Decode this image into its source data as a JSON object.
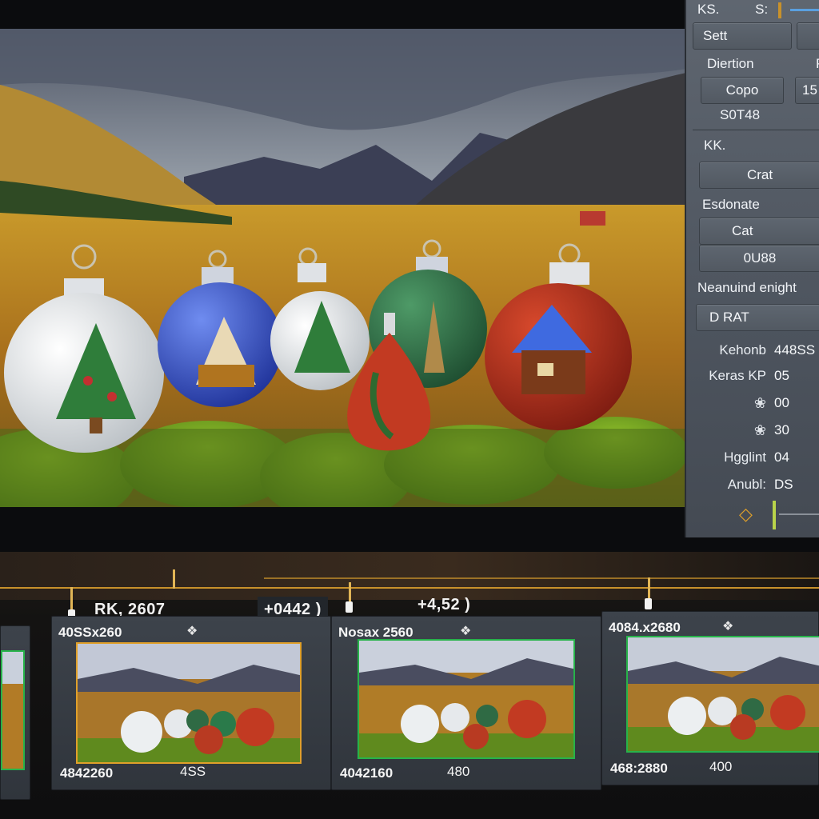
{
  "inspector": {
    "top_left": "KS.",
    "top_mid": "S:",
    "set_label": "Sett",
    "direction_label": "Diertion",
    "direction_right": "P",
    "copo_button": "Copo",
    "copo_value": "15",
    "code": "S0T48",
    "kk_label": "KK.",
    "crat_button": "Crat",
    "estimate_label": "Esdonate",
    "cat_label": "Cat",
    "value_field": "0U88",
    "height_label": "Neanuind enight",
    "drat_button": "D RAT",
    "kv": [
      {
        "key": "Kehonb",
        "value": "448SS"
      },
      {
        "key": "Keras KP",
        "value": "05"
      },
      {
        "key": "❀",
        "value": "00"
      },
      {
        "key": "❀",
        "value": "30"
      },
      {
        "key": "Hgglint",
        "value": "04"
      },
      {
        "key": "Anubl:",
        "value": "DS"
      }
    ],
    "diamond": "◇"
  },
  "timeline": {
    "labels": [
      {
        "text": "RK, 2607"
      },
      {
        "text": "+0442 )"
      },
      {
        "text": "+4,52 )"
      }
    ],
    "clips": [
      {
        "resolution": "40SSx260",
        "icon": "❖",
        "footer_a": "4842260",
        "footer_b": "4SS"
      },
      {
        "resolution": "Nosax 2560",
        "icon": "❖",
        "footer_a": "4042160",
        "footer_b": "480"
      },
      {
        "resolution": "4084.x2680",
        "icon": "❖",
        "footer_a": "468:2880",
        "footer_b": "400"
      }
    ]
  },
  "colors": {
    "panel": "#555c66",
    "accent_orange": "#c8912b",
    "clip_selected": "#e0a02a",
    "clip_border": "#27b34a"
  }
}
